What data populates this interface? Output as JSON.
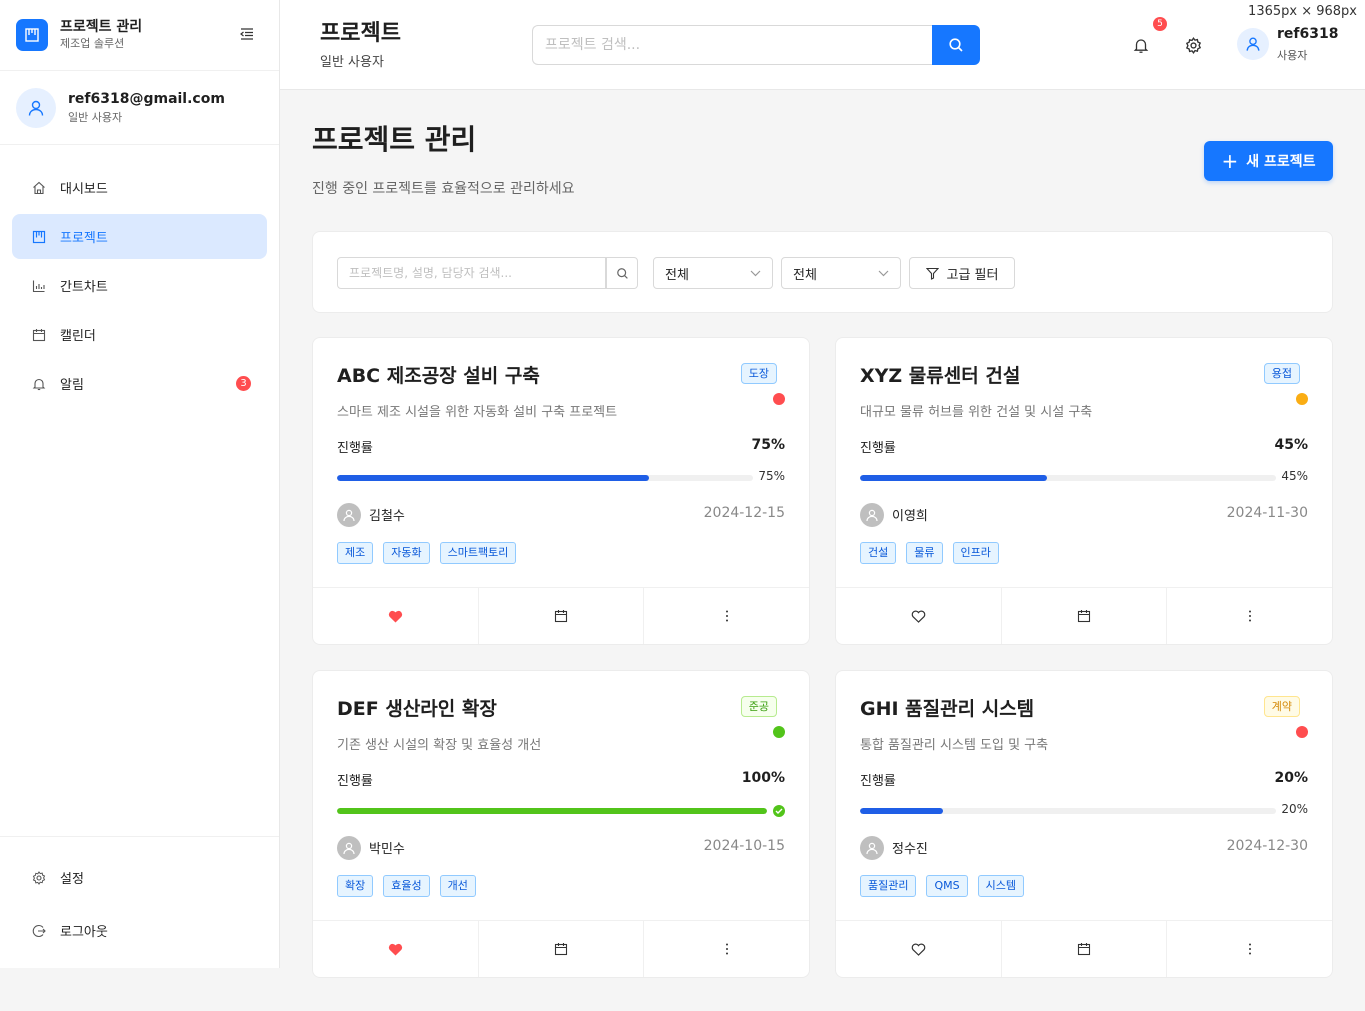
{
  "brand": {
    "title": "프로젝트 관리",
    "subtitle": "제조업 솔루션"
  },
  "sidebar_user": {
    "email": "ref6318@gmail.com",
    "role": "일반 사용자"
  },
  "nav": [
    {
      "label": "대시보드",
      "icon": "home-icon"
    },
    {
      "label": "프로젝트",
      "icon": "project-icon",
      "active": true
    },
    {
      "label": "간트차트",
      "icon": "bar-chart-icon"
    },
    {
      "label": "캘린더",
      "icon": "calendar-icon"
    },
    {
      "label": "알림",
      "icon": "bell-icon",
      "badge": "3"
    }
  ],
  "nav_bottom": [
    {
      "label": "설정",
      "icon": "gear-icon"
    },
    {
      "label": "로그아웃",
      "icon": "logout-icon"
    }
  ],
  "header": {
    "title": "프로젝트",
    "subtitle": "일반 사용자",
    "search_placeholder": "프로젝트 검색...",
    "notification_count": "5",
    "username": "ref6318",
    "user_role": "사용자",
    "dimension_label": "1365px × 968px"
  },
  "page": {
    "title": "프로젝트 관리",
    "subtitle": "진행 중인 프로젝트를 효율적으로 관리하세요",
    "new_button": "새 프로젝트"
  },
  "filters": {
    "search_placeholder": "프로젝트명, 설명, 담당자 검색...",
    "status_select": "전체",
    "type_select": "전체",
    "advanced_button": "고급 필터"
  },
  "progress_label": "진행률",
  "projects": [
    {
      "title": "ABC 제조공장 설비 구축",
      "tag": "도장",
      "tag_style": "blue",
      "priority_color": "#ff4d4f",
      "description": "스마트 제조 시설을 위한 자동화 설비 구축 프로젝트",
      "progress": 75,
      "progress_text": "75%",
      "bar_color": "#1f5ee6",
      "owner": "김철수",
      "date": "2024-12-15",
      "chips": [
        "제조",
        "자동화",
        "스마트팩토리"
      ],
      "favorite": true,
      "completed": false
    },
    {
      "title": "XYZ 물류센터 건설",
      "tag": "용접",
      "tag_style": "blue",
      "priority_color": "#faad14",
      "description": "대규모 물류 허브를 위한 건설 및 시설 구축",
      "progress": 45,
      "progress_text": "45%",
      "bar_color": "#1f5ee6",
      "owner": "이영희",
      "date": "2024-11-30",
      "chips": [
        "건설",
        "물류",
        "인프라"
      ],
      "favorite": false,
      "completed": false
    },
    {
      "title": "DEF 생산라인 확장",
      "tag": "준공",
      "tag_style": "green",
      "priority_color": "#52c41a",
      "description": "기존 생산 시설의 확장 및 효율성 개선",
      "progress": 100,
      "progress_text": "100%",
      "bar_color": "#52c41a",
      "owner": "박민수",
      "date": "2024-10-15",
      "chips": [
        "확장",
        "효율성",
        "개선"
      ],
      "favorite": true,
      "completed": true
    },
    {
      "title": "GHI 품질관리 시스템",
      "tag": "계약",
      "tag_style": "gold",
      "priority_color": "#ff4d4f",
      "description": "통합 품질관리 시스템 도입 및 구축",
      "progress": 20,
      "progress_text": "20%",
      "bar_color": "#1f5ee6",
      "owner": "정수진",
      "date": "2024-12-30",
      "chips": [
        "품질관리",
        "QMS",
        "시스템"
      ],
      "favorite": false,
      "completed": false
    }
  ],
  "colors": {
    "accent": "#1677ff",
    "danger": "#ff4d4f",
    "success": "#52c41a",
    "warning": "#faad14"
  }
}
